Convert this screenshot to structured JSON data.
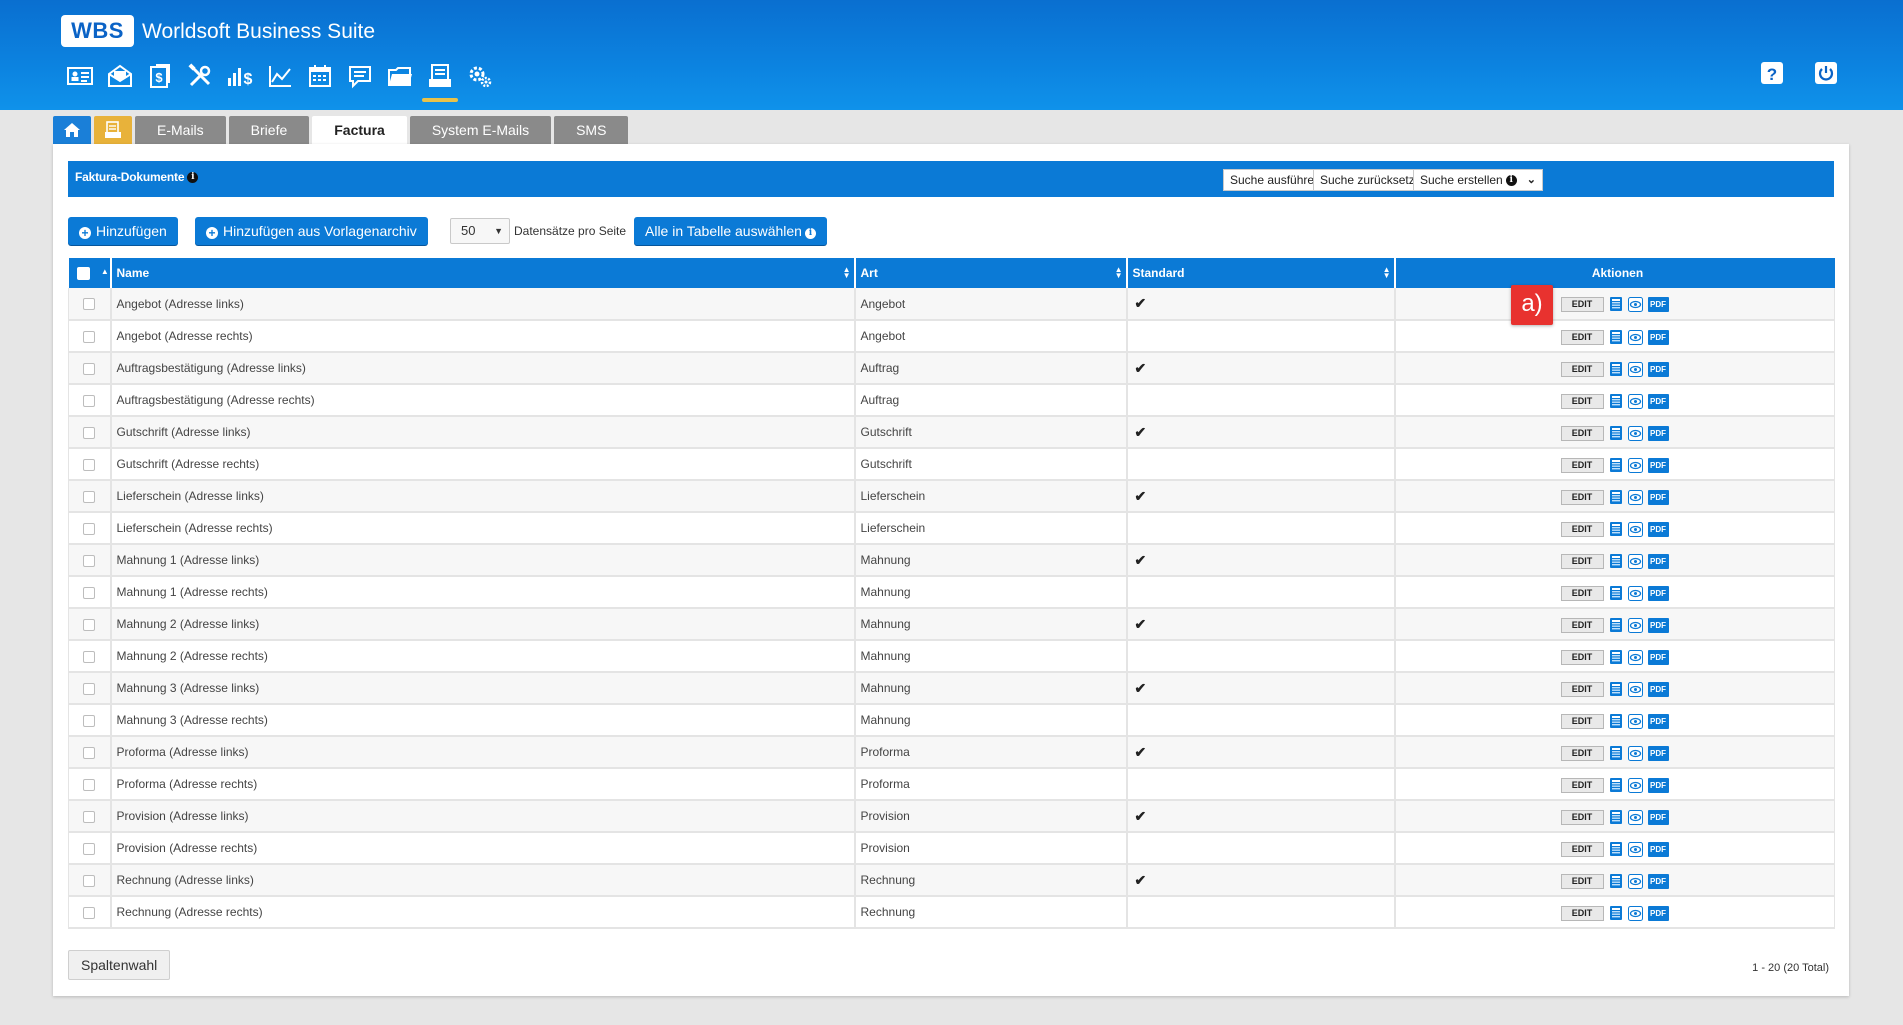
{
  "header": {
    "logo": "WBS",
    "title": "Worldsoft Business Suite",
    "nav_icons": [
      "contacts-icon",
      "mail-icon",
      "finance-icon",
      "tools-icon",
      "sales-icon",
      "chart-icon",
      "calendar-icon",
      "chat-icon",
      "folder-icon",
      "documents-icon",
      "settings-icon"
    ],
    "active_nav": "documents-icon",
    "right_icons": [
      "help-icon",
      "power-icon"
    ]
  },
  "tabs": [
    {
      "label": "",
      "icon": "home-icon"
    },
    {
      "label": "",
      "icon": "documents-icon"
    },
    {
      "label": "E-Mails"
    },
    {
      "label": "Briefe"
    },
    {
      "label": "Factura",
      "active": true
    },
    {
      "label": "System E-Mails"
    },
    {
      "label": "SMS"
    }
  ],
  "panel": {
    "title": "Faktura-Dokumente",
    "search_execute": "Suche ausführen",
    "search_reset": "Suche zurücksetzen",
    "search_create": "Suche erstellen"
  },
  "toolbar": {
    "add": "Hinzufügen",
    "add_from_archive": "Hinzufügen aus Vorlagenarchiv",
    "per_page": "50",
    "per_page_label": "Datensätze pro Seite",
    "select_all": "Alle in Tabelle auswählen"
  },
  "table": {
    "columns": [
      "Name",
      "Art",
      "Standard",
      "Aktionen"
    ],
    "edit_label": "EDIT",
    "pdf_label": "PDF",
    "rows": [
      {
        "name": "Angebot (Adresse links)",
        "art": "Angebot",
        "standard": "✔"
      },
      {
        "name": "Angebot (Adresse rechts)",
        "art": "Angebot",
        "standard": ""
      },
      {
        "name": "Auftragsbestätigung (Adresse links)",
        "art": "Auftrag",
        "standard": "✔"
      },
      {
        "name": "Auftragsbestätigung (Adresse rechts)",
        "art": "Auftrag",
        "standard": ""
      },
      {
        "name": "Gutschrift (Adresse links)",
        "art": "Gutschrift",
        "standard": "✔"
      },
      {
        "name": "Gutschrift (Adresse rechts)",
        "art": "Gutschrift",
        "standard": ""
      },
      {
        "name": "Lieferschein (Adresse links)",
        "art": "Lieferschein",
        "standard": "✔"
      },
      {
        "name": "Lieferschein (Adresse rechts)",
        "art": "Lieferschein",
        "standard": ""
      },
      {
        "name": "Mahnung 1 (Adresse links)",
        "art": "Mahnung",
        "standard": "✔"
      },
      {
        "name": "Mahnung 1 (Adresse rechts)",
        "art": "Mahnung",
        "standard": ""
      },
      {
        "name": "Mahnung 2 (Adresse links)",
        "art": "Mahnung",
        "standard": "✔"
      },
      {
        "name": "Mahnung 2 (Adresse rechts)",
        "art": "Mahnung",
        "standard": ""
      },
      {
        "name": "Mahnung 3 (Adresse links)",
        "art": "Mahnung",
        "standard": "✔"
      },
      {
        "name": "Mahnung 3 (Adresse rechts)",
        "art": "Mahnung",
        "standard": ""
      },
      {
        "name": "Proforma (Adresse links)",
        "art": "Proforma",
        "standard": "✔"
      },
      {
        "name": "Proforma (Adresse rechts)",
        "art": "Proforma",
        "standard": ""
      },
      {
        "name": "Provision (Adresse links)",
        "art": "Provision",
        "standard": "✔"
      },
      {
        "name": "Provision (Adresse rechts)",
        "art": "Provision",
        "standard": ""
      },
      {
        "name": "Rechnung (Adresse links)",
        "art": "Rechnung",
        "standard": "✔"
      },
      {
        "name": "Rechnung (Adresse rechts)",
        "art": "Rechnung",
        "standard": ""
      }
    ]
  },
  "annotation": "a)",
  "footer": {
    "column_select": "Spaltenwahl",
    "pagination": "1 - 20 (20 Total)"
  },
  "colors": {
    "header_blue": "#0c83e0",
    "accent_blue": "#0b7ad6",
    "active_underline": "#e8c24a",
    "docs_tab": "#e8b23a",
    "callout_red": "#e8322f"
  }
}
